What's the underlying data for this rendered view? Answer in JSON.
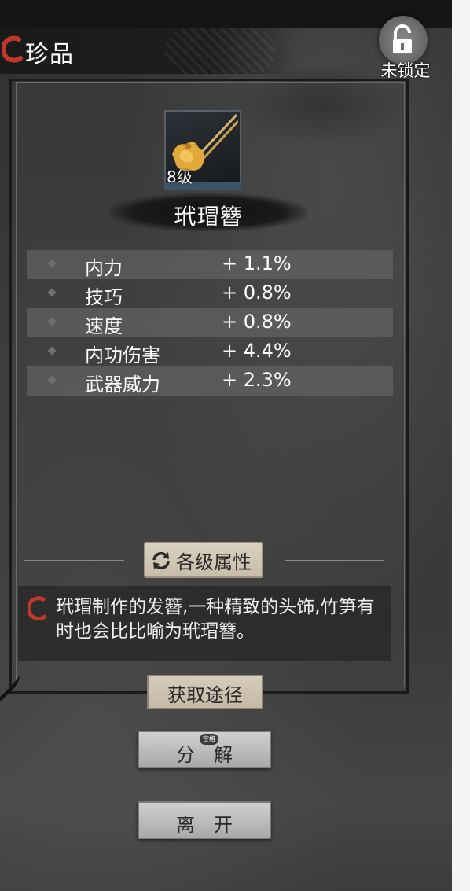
{
  "header": {
    "title": "珍品"
  },
  "lock": {
    "label": "未锁定"
  },
  "item": {
    "level": "8级",
    "name": "玳瑁簪"
  },
  "stats": [
    {
      "name": "内力",
      "value": "+ 1.1%"
    },
    {
      "name": "技巧",
      "value": "+ 0.8%"
    },
    {
      "name": "速度",
      "value": "+ 0.8%"
    },
    {
      "name": "内功伤害",
      "value": "+ 4.4%"
    },
    {
      "name": "武器威力",
      "value": "+ 2.3%"
    }
  ],
  "buttons": {
    "levels": "各级属性",
    "source": "获取途径",
    "decompose": "分解",
    "leave": "离开",
    "key_hint": "空格"
  },
  "description": "玳瑁制作的发簪,一种精致的头饰,竹笋有时也会比比喻为玳瑁簪。",
  "colors": {
    "accent_red": "#c0392b",
    "button_beige": "#d9d0c0"
  }
}
